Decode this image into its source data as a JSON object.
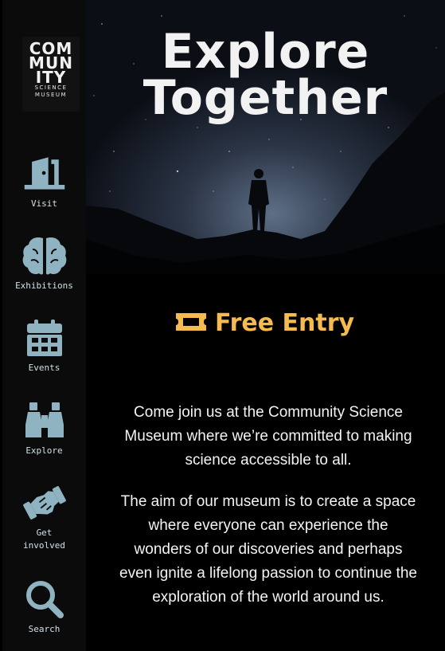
{
  "logo": {
    "line1": "COM",
    "line2": "MUN",
    "line3": "ITY",
    "line4": "SCIENCE",
    "line5": "MUSEUM"
  },
  "nav": {
    "visit": "Visit",
    "exhibitions": "Exhibitions",
    "events": "Events",
    "explore": "Explore",
    "get_involved_1": "Get",
    "get_involved_2": "involved",
    "search": "Search"
  },
  "hero": {
    "title_line1": "Explore",
    "title_line2": "Together"
  },
  "entry": {
    "label": "Free Entry"
  },
  "content": {
    "para1": "Come join us at the Community Science Museum where we’re committed to making science accessible to all.",
    "para2": "The aim of our museum is to create a space where everyone can experience the wonders of our discoveries and perhaps even ignite a lifelong passion to continue the exploration of the world around us."
  },
  "colors": {
    "accent": "#f6bb4e",
    "icon": "#8fb3c0",
    "background": "#000000"
  }
}
